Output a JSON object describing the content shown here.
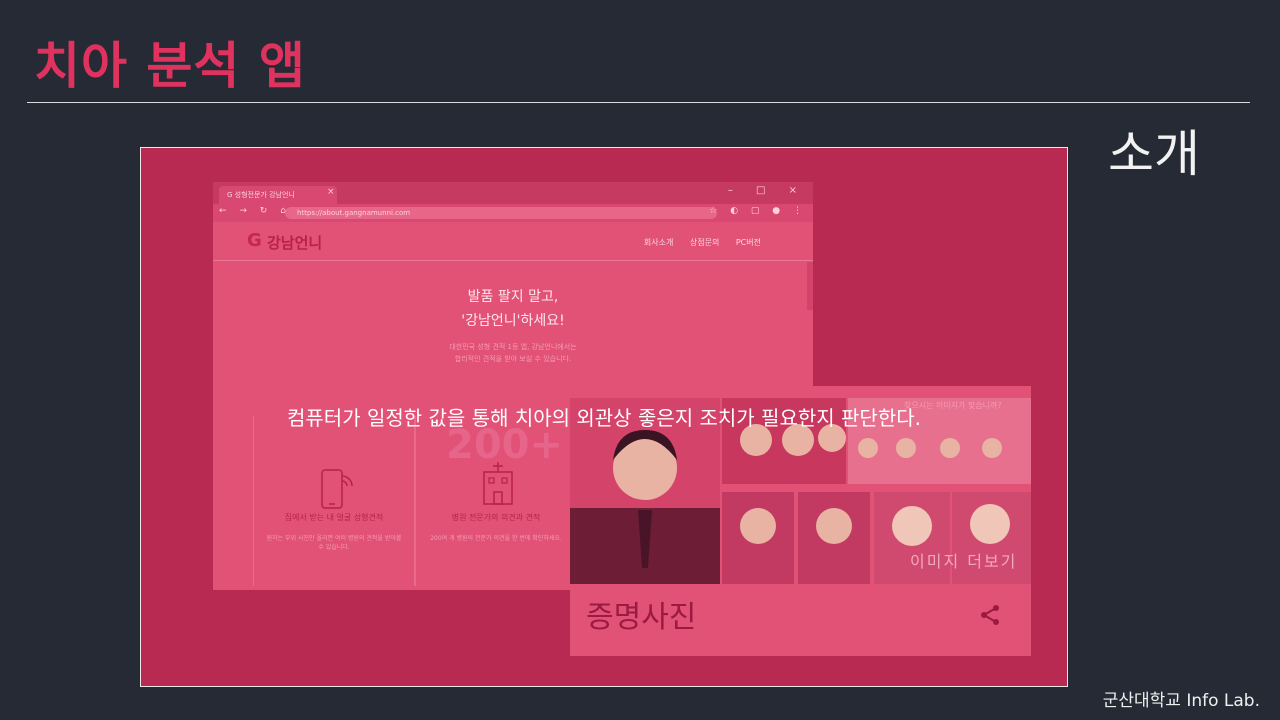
{
  "slide": {
    "title": "치아 분석 앱",
    "section": "소개",
    "footer": "군산대학교 Info Lab.",
    "overlay_text": "컴퓨터가 일정한 값을 통해 치아의 외관상 좋은지 조치가 필요한지 판단한다."
  },
  "browser": {
    "tab_title": "G 성형전문가 강남언니",
    "tab_close": "×",
    "window_controls": "– □ ×",
    "nav_icons": "← → ↻ ⌂",
    "url": "https://about.gangnamunni.com",
    "tool_icons": "☆ ◐ ▢ ● ⋮"
  },
  "site": {
    "logo_g": "G",
    "logo": "강남언니",
    "menu": [
      "회사소개",
      "상점문의",
      "PC버전"
    ],
    "hero_line1": "발품 팔지 말고,",
    "hero_line2": "'강남언니'하세요!",
    "hero_sub1": "대한민국 성형 견적 1등 앱, 강남언니에서는",
    "hero_sub2": "합리적인 견적을 받아 보실 수 있습니다.",
    "cards": [
      {
        "big": "",
        "caption": "집에서 받는 내 얼굴 성형견적",
        "desc": "원하는 부위 사진만 올리면 여러 병원의 견적을 받아볼 수 있습니다."
      },
      {
        "big": "200+",
        "caption": "병원 전문가의 의견과 견적",
        "desc": "200여 개 병원의 전문가 의견을 한 번에 확인하세요."
      }
    ]
  },
  "image_card": {
    "caption": "증명사진",
    "more_label": "이미지 더보기",
    "question": "찾으시는 이미지가 맞습니까?"
  }
}
